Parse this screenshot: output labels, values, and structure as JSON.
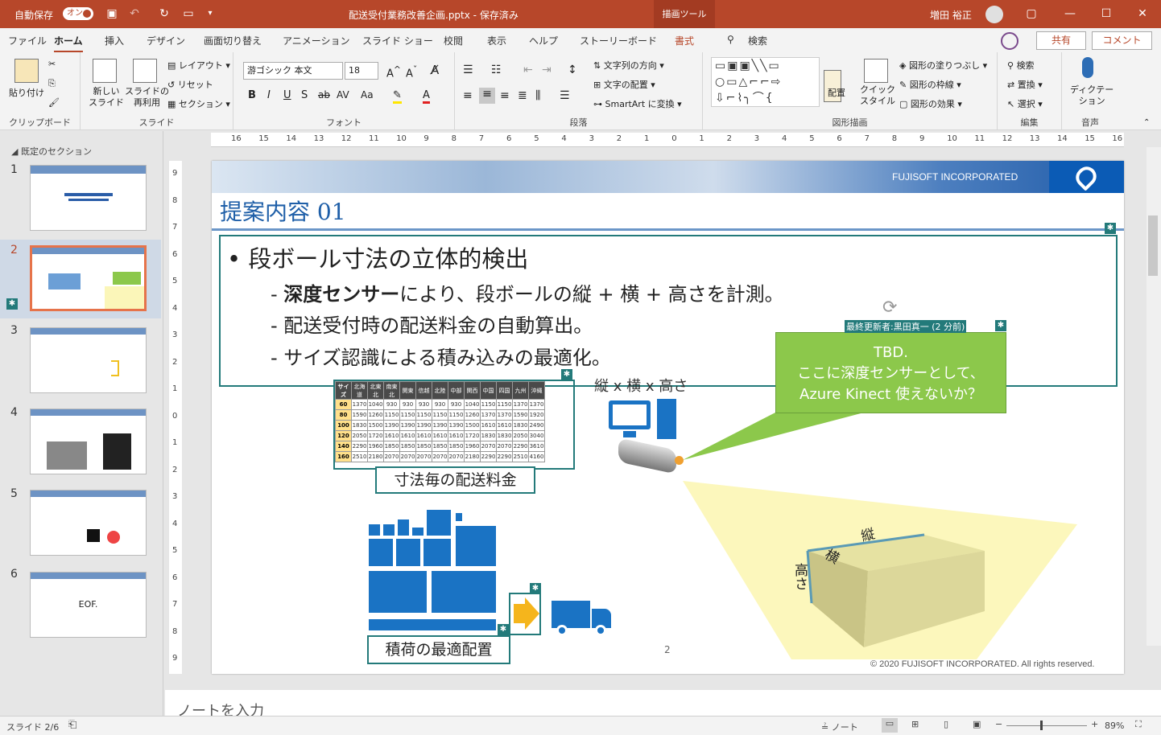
{
  "titlebar": {
    "autosave": "自動保存",
    "toggle": "オン",
    "filename": "配送受付業務改善企画.pptx - 保存済み",
    "contextual": "描画ツール",
    "user": "増田 裕正"
  },
  "tabs": [
    "ファイル",
    "ホーム",
    "挿入",
    "デザイン",
    "画面切り替え",
    "アニメーション",
    "スライド ショー",
    "校閲",
    "表示",
    "ヘルプ",
    "ストーリーボード",
    "書式"
  ],
  "search": "検索",
  "share": "共有",
  "comment": "コメント",
  "ribbon": {
    "clipboard": {
      "paste": "貼り付け",
      "label": "クリップボード"
    },
    "slides": {
      "new": "新しい\nスライド",
      "reuse": "スライドの\n再利用",
      "layout": "レイアウト",
      "reset": "リセット",
      "section": "セクション",
      "label": "スライド"
    },
    "font": {
      "name": "游ゴシック 本文",
      "size": "18",
      "label": "フォント"
    },
    "paragraph": {
      "direction": "文字列の方向",
      "align": "文字の配置",
      "smartart": "SmartArt に変換",
      "label": "段落"
    },
    "drawing": {
      "arrange": "配置",
      "quick": "クイック\nスタイル",
      "fill": "図形の塗りつぶし",
      "outline": "図形の枠線",
      "effect": "図形の効果",
      "label": "図形描画"
    },
    "editing": {
      "find": "検索",
      "replace": "置換",
      "select": "選択",
      "label": "編集"
    },
    "voice": {
      "dictate": "ディクテー\nション",
      "label": "音声"
    }
  },
  "ruler": [
    "16",
    "15",
    "14",
    "13",
    "12",
    "11",
    "10",
    "9",
    "8",
    "7",
    "6",
    "5",
    "4",
    "3",
    "2",
    "1",
    "0",
    "1",
    "2",
    "3",
    "4",
    "5",
    "6",
    "7",
    "8",
    "9",
    "10",
    "11",
    "12",
    "13",
    "14",
    "15",
    "16"
  ],
  "section": "既定のセクション",
  "thumbs": [
    "1",
    "2",
    "3",
    "4",
    "5",
    "6"
  ],
  "thumb6text": "EOF.",
  "slide": {
    "company": "FUJISOFT INCORPORATED",
    "title": "提案内容 01",
    "bullet1": "段ボール寸法の立体的検出",
    "sub1_bold": "深度センサー",
    "sub1_rest": "により、段ボールの縦 + 横 + 高さを計測。",
    "sub2": "配送受付時の配送料金の自動算出。",
    "sub3": "サイズ認識による積み込みの最適化。",
    "editor": "最終更新者:黒田真一 (2 分前)",
    "callout": [
      "TBD.",
      "ここに深度センサーとして、",
      "Azure Kinect 使えないか？"
    ],
    "dims": "縦 x 横 x 高さ",
    "rate_caption": "寸法毎の配送料金",
    "load_caption": "積荷の最適配置",
    "box_labels": {
      "tate": "縦",
      "yoko": "横",
      "takasa": "高さ"
    },
    "page": "2",
    "copyright": "© 2020 FUJISOFT INCORPORATED. All rights reserved.",
    "rate_header": [
      "サイズ",
      "北海道",
      "北東北",
      "南東北",
      "関東",
      "信越",
      "北陸",
      "中部",
      "関西",
      "中国",
      "四国",
      "九州",
      "沖縄"
    ],
    "rate_rows": [
      [
        "60",
        "1370",
        "1040",
        "930",
        "930",
        "930",
        "930",
        "930",
        "1040",
        "1150",
        "1150",
        "1370",
        "1370"
      ],
      [
        "80",
        "1590",
        "1260",
        "1150",
        "1150",
        "1150",
        "1150",
        "1150",
        "1260",
        "1370",
        "1370",
        "1590",
        "1920"
      ],
      [
        "100",
        "1830",
        "1500",
        "1390",
        "1390",
        "1390",
        "1390",
        "1390",
        "1500",
        "1610",
        "1610",
        "1830",
        "2490"
      ],
      [
        "120",
        "2050",
        "1720",
        "1610",
        "1610",
        "1610",
        "1610",
        "1610",
        "1720",
        "1830",
        "1830",
        "2050",
        "3040"
      ],
      [
        "140",
        "2290",
        "1960",
        "1850",
        "1850",
        "1850",
        "1850",
        "1850",
        "1960",
        "2070",
        "2070",
        "2290",
        "3610"
      ],
      [
        "160",
        "2510",
        "2180",
        "2070",
        "2070",
        "2070",
        "2070",
        "2070",
        "2180",
        "2290",
        "2290",
        "2510",
        "4160"
      ]
    ]
  },
  "notes": "ノートを入力",
  "status": {
    "slide": "スライド 2/6",
    "notes": "ノート",
    "zoom": "89%"
  }
}
